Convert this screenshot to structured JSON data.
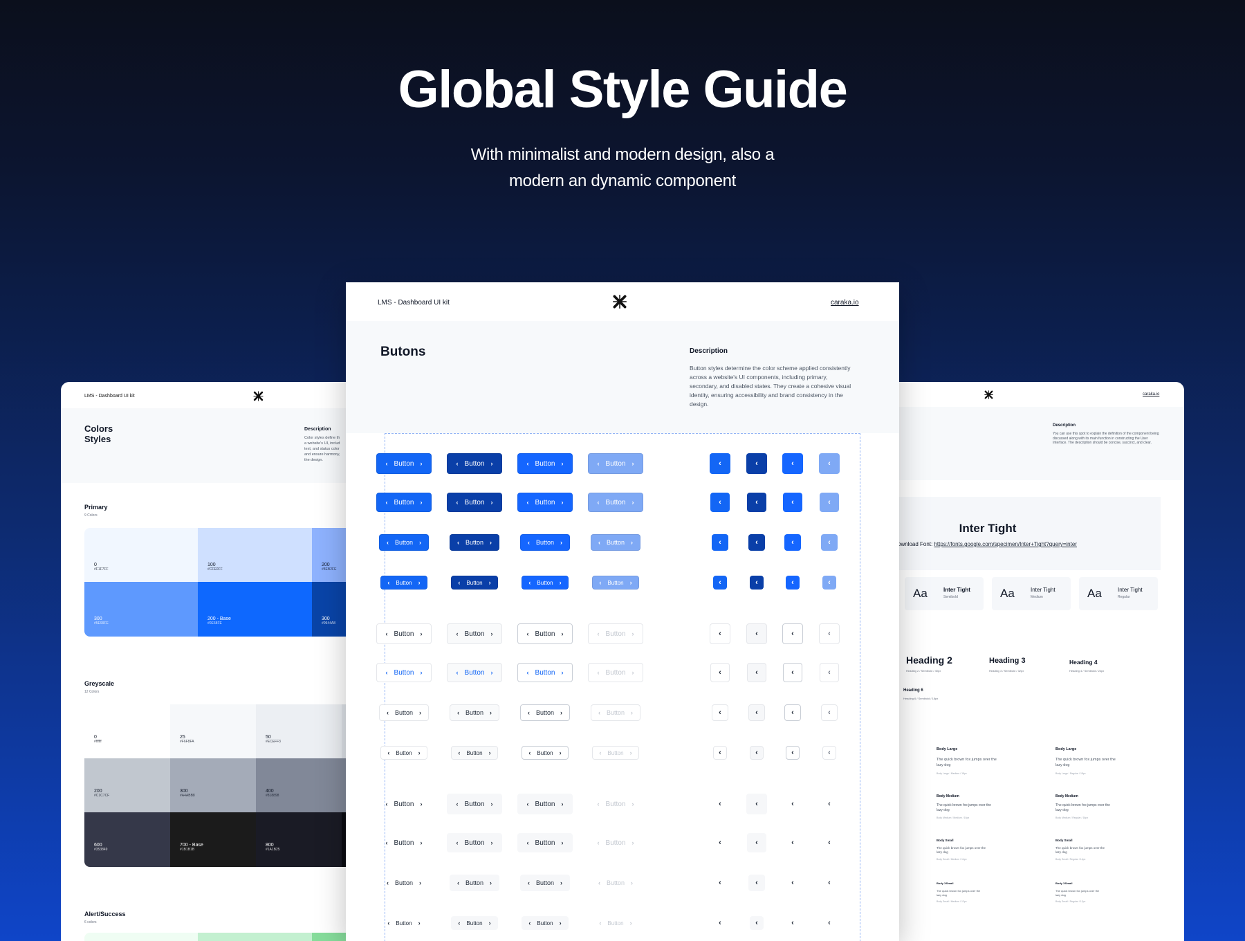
{
  "hero": {
    "title": "Global Style Guide",
    "subtitle_line1": "With minimalist and modern design, also a",
    "subtitle_line2": "modern an dynamic component"
  },
  "center": {
    "kit_name": "LMS - Dashboard UI kit",
    "site": "caraka.io",
    "section_title": "Butons",
    "desc_title": "Description",
    "desc_text": "Button styles determine the color scheme applied consistently across a website's UI components, including primary, secondary, and disabled states. They create a cohesive visual identity, ensuring accessibility and brand consistency in the design.",
    "button_label": "Button",
    "chevron_left": "‹",
    "chevron_right": "›",
    "colors": {
      "primary": "#1366f5",
      "primary_dark": "#0a3fa8",
      "primary_mid": "#1566ff",
      "disabled": "#7fa9f5"
    }
  },
  "left": {
    "kit_name": "LMS - Dashboard UI kit",
    "title_line1": "Colors",
    "title_line2": "Styles",
    "desc_title": "Description",
    "desc_lines": [
      "Color styles define th",
      "a website's UI, includ",
      "text, and status color",
      "and ensure harmony,",
      "the design."
    ],
    "primary": {
      "title": "Primary",
      "count": "9 Colors",
      "swatches": [
        {
          "name": "0",
          "hex": "#F1F7FF"
        },
        {
          "name": "100",
          "hex": "#CFE0FF"
        },
        {
          "name": "200",
          "hex": "#8EB2FE"
        },
        {
          "name": "300",
          "hex": "#5E99FE"
        },
        {
          "name": "200 - Base",
          "hex": "#0E68FE"
        },
        {
          "name": "300",
          "hex": "#0944A8"
        }
      ]
    },
    "greyscale": {
      "title": "Greyscale",
      "count": "12 Colors",
      "swatches": [
        {
          "name": "0",
          "hex": "#ffffff"
        },
        {
          "name": "25",
          "hex": "#F6F8FA"
        },
        {
          "name": "50",
          "hex": "#ECEFF3"
        },
        {
          "name": "200",
          "hex": "#C1C7CF"
        },
        {
          "name": "300",
          "hex": "#A4ABB8"
        },
        {
          "name": "400",
          "hex": "#818898"
        },
        {
          "name": "600",
          "hex": "#353849"
        },
        {
          "name": "700 - Base",
          "hex": "#1B1B1B"
        },
        {
          "name": "800",
          "hex": "#1A1B25"
        }
      ]
    },
    "alert": {
      "title": "Alert/Success",
      "count": "6 colors"
    }
  },
  "right": {
    "site": "caraka.io",
    "desc_title": "Description",
    "desc_text": "You can use this spot to explain the definition of the component being discussed along with its main function in constructing the User Interface. The description should be concise, succinct, and clear.",
    "font_name": "Inter Tight",
    "download_prefix": "ownload Font: ",
    "download_link": "https://fonts.google.com/specimen/Inter+Tight?query=inter",
    "specimens": [
      {
        "aa": "Aa",
        "name": "Inter Tight",
        "weight": "Semibold"
      },
      {
        "aa": "Aa",
        "name": "Inter Tight",
        "weight": "Medium"
      },
      {
        "aa": "Aa",
        "name": "Inter Tight",
        "weight": "Regular"
      }
    ],
    "headings": [
      {
        "label": "Heading 2",
        "meta": "Heading 2 / Semibold / 40px"
      },
      {
        "label": "Heading 3",
        "meta": "Heading 3 / Semibold / 32px"
      },
      {
        "label": "Heading 4",
        "meta": "Heading 4 / Semibold / 24px"
      },
      {
        "label": "Heading 6",
        "meta": "Heading 6 / Semibold / 18px"
      }
    ],
    "body": [
      {
        "title": "Body Large",
        "text": "The quick brown fox jumps over the lazy dog",
        "meta": "Body Large / Medium / 18px"
      },
      {
        "title": "Body Large",
        "text": "The quick brown fox jumps over the lazy dog",
        "meta": "Body Large / Regular / 18px"
      },
      {
        "title": "Body Medium",
        "text": "The quick brown fox jumps over the lazy dog",
        "meta": "Body Medium / Medium / 16px"
      },
      {
        "title": "Body Medium",
        "text": "The quick brown fox jumps over the lazy dog",
        "meta": "Body Medium / Regular / 16px"
      },
      {
        "title": "Body Small",
        "text": "The quick brown fox jumps over the lazy dog",
        "meta": "Body Small / Medium / 14px"
      },
      {
        "title": "Body Small",
        "text": "The quick brown fox jumps over the lazy dog",
        "meta": "Body Small / Regular / 14px"
      },
      {
        "title": "Body XSmall",
        "text": "The quick brown fox jumps over the lazy dog",
        "meta": "Body Small / Medium / 12px"
      },
      {
        "title": "Body XSmall",
        "text": "The quick brown fox jumps over the lazy dog",
        "meta": "Body Small / Regular / 12px"
      }
    ]
  }
}
